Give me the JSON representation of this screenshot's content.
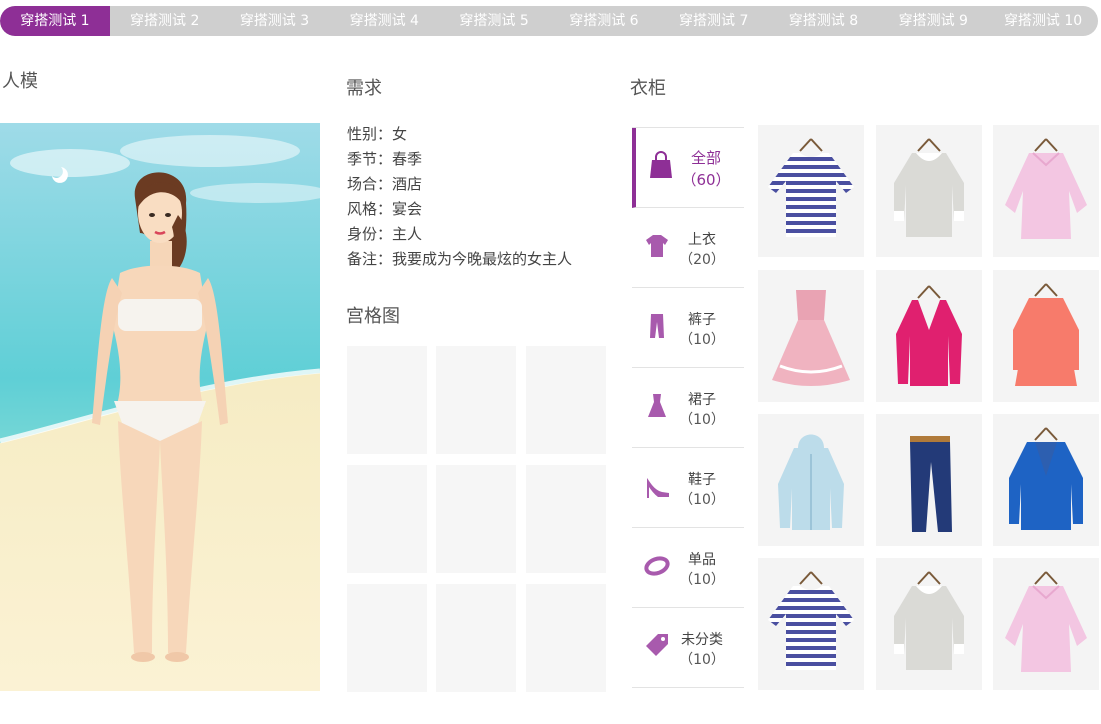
{
  "tabs": [
    {
      "label": "穿搭测试 1"
    },
    {
      "label": "穿搭测试 2"
    },
    {
      "label": "穿搭测试 3"
    },
    {
      "label": "穿搭测试 4"
    },
    {
      "label": "穿搭测试 5"
    },
    {
      "label": "穿搭测试 6"
    },
    {
      "label": "穿搭测试 7"
    },
    {
      "label": "穿搭测试 8"
    },
    {
      "label": "穿搭测试 9"
    },
    {
      "label": "穿搭测试 10"
    }
  ],
  "model": {
    "title": "人模"
  },
  "requirements": {
    "title": "需求",
    "rows": [
      {
        "text": "性别：女"
      },
      {
        "text": "季节：春季"
      },
      {
        "text": "场合：酒店"
      },
      {
        "text": "风格：宴会"
      },
      {
        "text": "身份：主人"
      },
      {
        "text": "备注：我要成为今晚最炫的女主人"
      }
    ]
  },
  "grid": {
    "title": "宫格图"
  },
  "wardrobe": {
    "title": "衣柜",
    "categories": [
      {
        "label": "全部",
        "count": "（60）",
        "icon": "shopping-bag-icon"
      },
      {
        "label": "上衣",
        "count": "（20）",
        "icon": "shirt-icon"
      },
      {
        "label": "裤子",
        "count": "（10）",
        "icon": "pants-icon"
      },
      {
        "label": "裙子",
        "count": "（10）",
        "icon": "dress-icon"
      },
      {
        "label": "鞋子",
        "count": "（10）",
        "icon": "high-heel-icon"
      },
      {
        "label": "单品",
        "count": "（10）",
        "icon": "bracelet-icon"
      },
      {
        "label": "未分类",
        "count": "（10）",
        "icon": "tag-icon"
      }
    ],
    "items": [
      {
        "name": "striped-top"
      },
      {
        "name": "lace-blouse"
      },
      {
        "name": "pink-shirt"
      },
      {
        "name": "pink-dress"
      },
      {
        "name": "magenta-cardigan"
      },
      {
        "name": "coral-coat"
      },
      {
        "name": "light-blue-hoodie"
      },
      {
        "name": "navy-jeans"
      },
      {
        "name": "blue-blazer"
      },
      {
        "name": "striped-top"
      },
      {
        "name": "lace-blouse"
      },
      {
        "name": "pink-shirt"
      }
    ]
  },
  "colors": {
    "accent": "#8e2f96",
    "tab_inactive": "#cfcfcf",
    "icon": "#a85aad"
  }
}
